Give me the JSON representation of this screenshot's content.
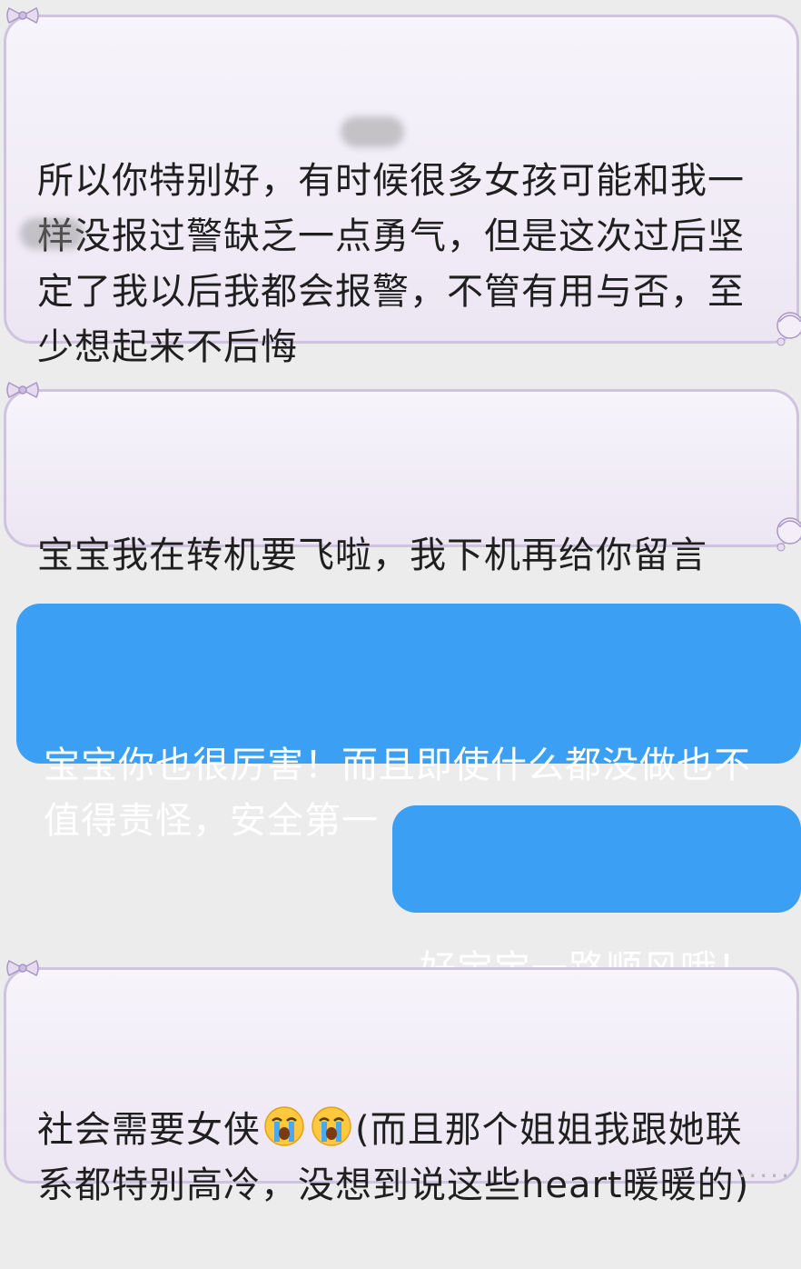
{
  "messages": [
    {
      "side": "incoming",
      "text": "所以你特别好，有时候很多女孩可能和我一样没报过警缺乏一点勇气，但是这次过后坚定了我以后我都会报警，不管有用与否，至少想起来不后悔"
    },
    {
      "side": "incoming",
      "text": "宝宝我在转机要飞啦，我下机再给你留言"
    },
    {
      "side": "outgoing",
      "text": "宝宝你也很厉害！而且即使什么都没做也不值得责怪，安全第一"
    },
    {
      "side": "outgoing",
      "text": "好宝宝一路顺风哦！"
    },
    {
      "side": "incoming",
      "text_before": "社会需要女侠",
      "text_after": "(而且那个姐姐我跟她联系都特别高冷，没想到说这些heart暖暖的)",
      "emoji": [
        "loudly-crying-face",
        "loudly-crying-face"
      ]
    }
  ],
  "watermark": "·····",
  "colors": {
    "incoming_bubble": "#f3eff8",
    "incoming_border": "#cfc4df",
    "outgoing_bubble": "#3b9ff3",
    "background": "#ececec"
  }
}
